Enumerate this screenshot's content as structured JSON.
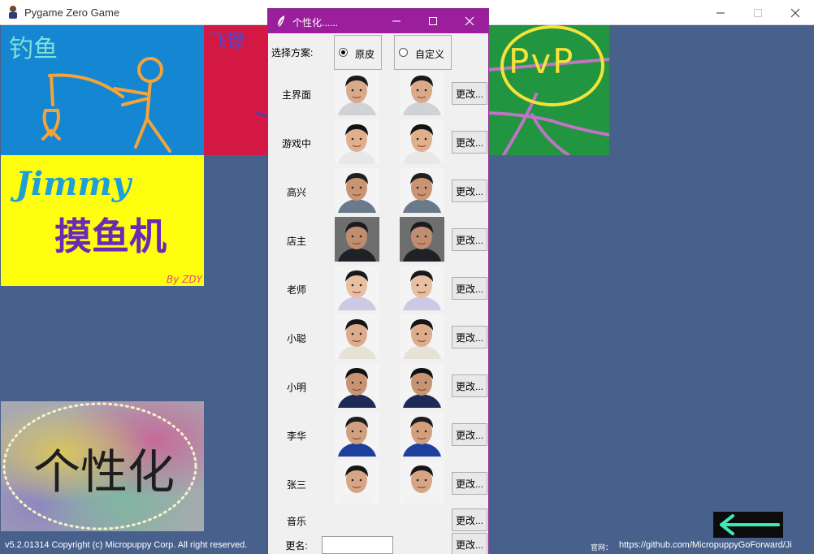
{
  "window": {
    "title": "Pygame Zero Game",
    "minimize_icon": "minimize-icon",
    "maximize_icon": "maximize-icon",
    "close_icon": "close-icon"
  },
  "tiles": {
    "fishing": {
      "label": "钓鱼",
      "bg": "#1586d2"
    },
    "darts": {
      "label": "飞镖",
      "bg": "#d31843"
    },
    "pvp": {
      "label": "PvP",
      "bg": "#21953f"
    },
    "jimmy": {
      "title": "Jimmy",
      "subtitle": "摸鱼机",
      "byline": "By ZDY",
      "bg": "#fffe0c"
    },
    "personalize": {
      "label": "个性化"
    }
  },
  "back_button": {
    "icon": "arrow-left-icon"
  },
  "footer": {
    "copyright": "v5.2.01314 Copyright (c) Micropuppy Corp. All right reserved.",
    "site_label": "官网：",
    "url": "https://github.com/MicropuppyGoForward/Ji"
  },
  "dialog": {
    "title": "个性化......",
    "title_bg": "#9b1f9c",
    "scheme_label": "选择方案:",
    "schemes": [
      {
        "label": "原皮",
        "selected": true
      },
      {
        "label": "自定义",
        "selected": false
      }
    ],
    "rows": [
      {
        "label": "主界面",
        "change": "更改..."
      },
      {
        "label": "游戏中",
        "change": "更改..."
      },
      {
        "label": "高兴",
        "change": "更改..."
      },
      {
        "label": "店主",
        "change": "更改..."
      },
      {
        "label": "老师",
        "change": "更改..."
      },
      {
        "label": "小聪",
        "change": "更改..."
      },
      {
        "label": "小明",
        "change": "更改..."
      },
      {
        "label": "李华",
        "change": "更改..."
      },
      {
        "label": "张三",
        "change": "更改..."
      }
    ],
    "music": {
      "label": "音乐",
      "change": "更改..."
    },
    "rename": {
      "label": "更名:",
      "value": "",
      "change": "更改..."
    }
  }
}
